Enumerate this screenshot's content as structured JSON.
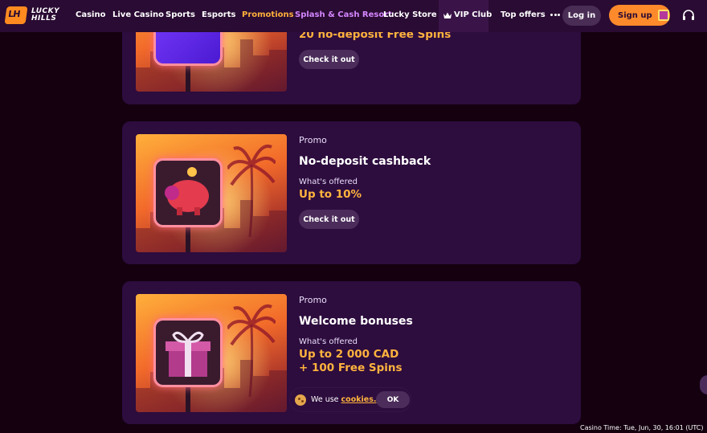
{
  "header": {
    "logo_text_line1": "LUCKY",
    "logo_text_line2": "HILLS",
    "logo_mark": "LH",
    "nav": [
      {
        "label": "Casino"
      },
      {
        "label": "Live Casino"
      },
      {
        "label": "Sports"
      },
      {
        "label": "Esports"
      },
      {
        "label": "Promotions"
      },
      {
        "label": "Splash & Cash Resort"
      },
      {
        "label": "Lucky Store"
      },
      {
        "label": "VIP Club"
      },
      {
        "label": "Top offers"
      }
    ],
    "login_label": "Log in",
    "signup_label": "Sign up",
    "colors": {
      "accent": "#ff8a2b",
      "header_bg": "#2a0b33",
      "promotions": "#ffb03a",
      "splash": "#d486ff"
    }
  },
  "cards": [
    {
      "offer_value": "20 no-deposit Free Spins",
      "cta_label": "Check it out",
      "image_icon": "lh-sign-icon"
    },
    {
      "label": "Promo",
      "title": "No-deposit cashback",
      "offer_label": "What's offered",
      "offer_value": "Up to 10%",
      "cta_label": "Check it out",
      "image_icon": "piggy-bank-icon"
    },
    {
      "label": "Promo",
      "title": "Welcome bonuses",
      "offer_label": "What's offered",
      "offer_value_line1": "Up to 2 000 CAD",
      "offer_value_line2": "+ 100 Free Spins",
      "image_icon": "gift-box-icon"
    }
  ],
  "cookie": {
    "text": "We use",
    "link": "cookies.",
    "ok_label": "OK"
  },
  "footer": {
    "casino_time": "Casino Time: Tue, Jun, 30, 16:01 (UTC)"
  }
}
